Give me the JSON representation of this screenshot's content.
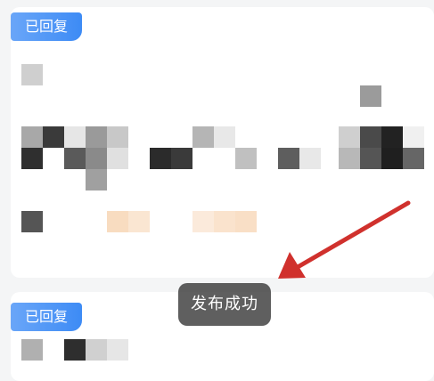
{
  "cards": [
    {
      "badge": "已回复"
    },
    {
      "badge": "已回复"
    }
  ],
  "toast": {
    "text": "发布成功"
  },
  "colors": {
    "badge_gradient_start": "#6aa6f8",
    "badge_gradient_end": "#3d8bf5",
    "arrow": "#d0312d",
    "toast_bg": "#323232"
  }
}
